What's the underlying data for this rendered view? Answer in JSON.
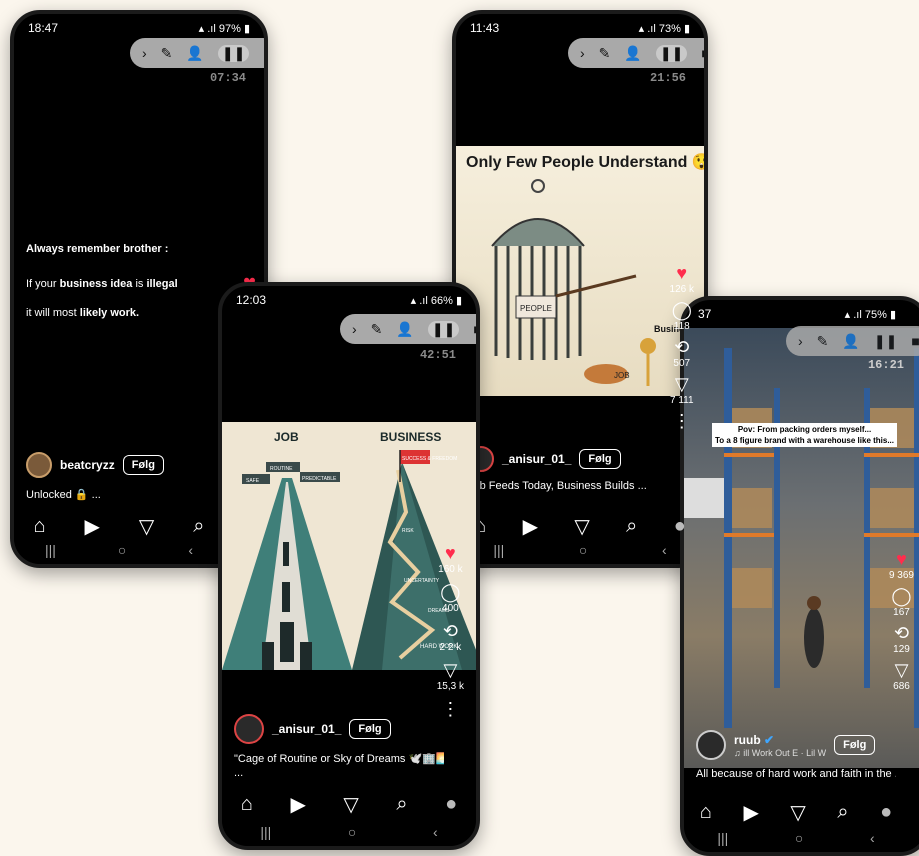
{
  "phone1": {
    "time": "18:47",
    "status_right": "97%",
    "timer": "07:34",
    "text1": "Always remember brother :",
    "text2_a": "If your ",
    "text2_b": "business idea",
    "text2_c": " is ",
    "text2_d": "illegal",
    "text3_a": "it will most ",
    "text3_b": "likely work.",
    "username": "beatcryzz",
    "follow": "Følg",
    "caption": "Unlocked 🔒 ..."
  },
  "phone2": {
    "time": "12:03",
    "status_right": "66%",
    "timer": "42:51",
    "label_job": "JOB",
    "label_business": "BUSINESS",
    "sign_safe": "SAFE",
    "sign_routine": "ROUTINE",
    "sign_predictable": "PREDICTABLE",
    "flag": "SUCCESS & FREEDOM",
    "risk": "RISK",
    "uncertainty": "UNCERTAINTY",
    "dreams": "DREAMS",
    "hard_work": "HARD WORK",
    "likes": "160 k",
    "comments": "400",
    "reposts": "2 2 k",
    "shares": "15,3 k",
    "username": "_anisur_01_",
    "follow": "Følg",
    "caption": "\"Cage of Routine or Sky of Dreams 🕊️🏢🌅",
    "caption2": "..."
  },
  "phone3": {
    "time": "11:43",
    "status_right": "73%",
    "timer": "21:56",
    "headline": "Only Few People Understand 😲",
    "people": "PEOPLE",
    "business": "Business",
    "job": "JOB",
    "likes": "126 k",
    "comments": "118",
    "reposts": "507",
    "shares": "7 111",
    "username": "_anisur_01_",
    "follow": "Følg",
    "caption": "Job Feeds Today, Business Builds ..."
  },
  "phone4": {
    "time": "37",
    "status_right": "75%",
    "timer": "16:21",
    "overlay1": "Pov: From packing orders myself...",
    "overlay2": "To a 8 figure brand with a warehouse like this...",
    "likes": "9 369",
    "comments": "167",
    "reposts": "129",
    "shares": "686",
    "username": "ruub",
    "music": "♫ ill Work Out  E · Lil W",
    "follow": "Følg",
    "caption": "All because of hard work and faith in the ..."
  },
  "nav": {
    "home": "⌂",
    "reels": "▶",
    "send": "▽",
    "search": "⌕",
    "profile": "●"
  },
  "sys": {
    "recent": "|||",
    "home": "○",
    "back": "‹"
  }
}
